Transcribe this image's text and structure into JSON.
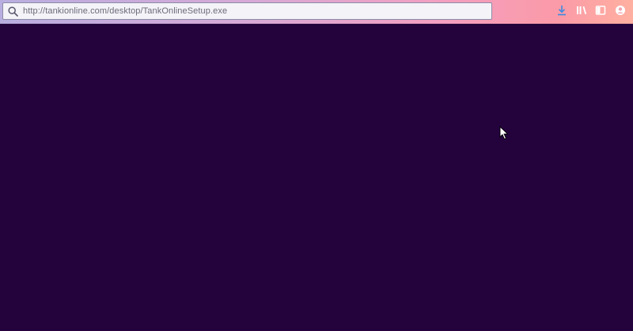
{
  "browser": {
    "url": "http://tankionline.com/desktop/TankOnlineSetup.exe",
    "toolbar_icons": [
      "download-icon",
      "library-icon",
      "sidebar-icon",
      "account-icon"
    ]
  },
  "colors": {
    "page_background": "#24033d",
    "download_icon": "#3d8be0"
  }
}
